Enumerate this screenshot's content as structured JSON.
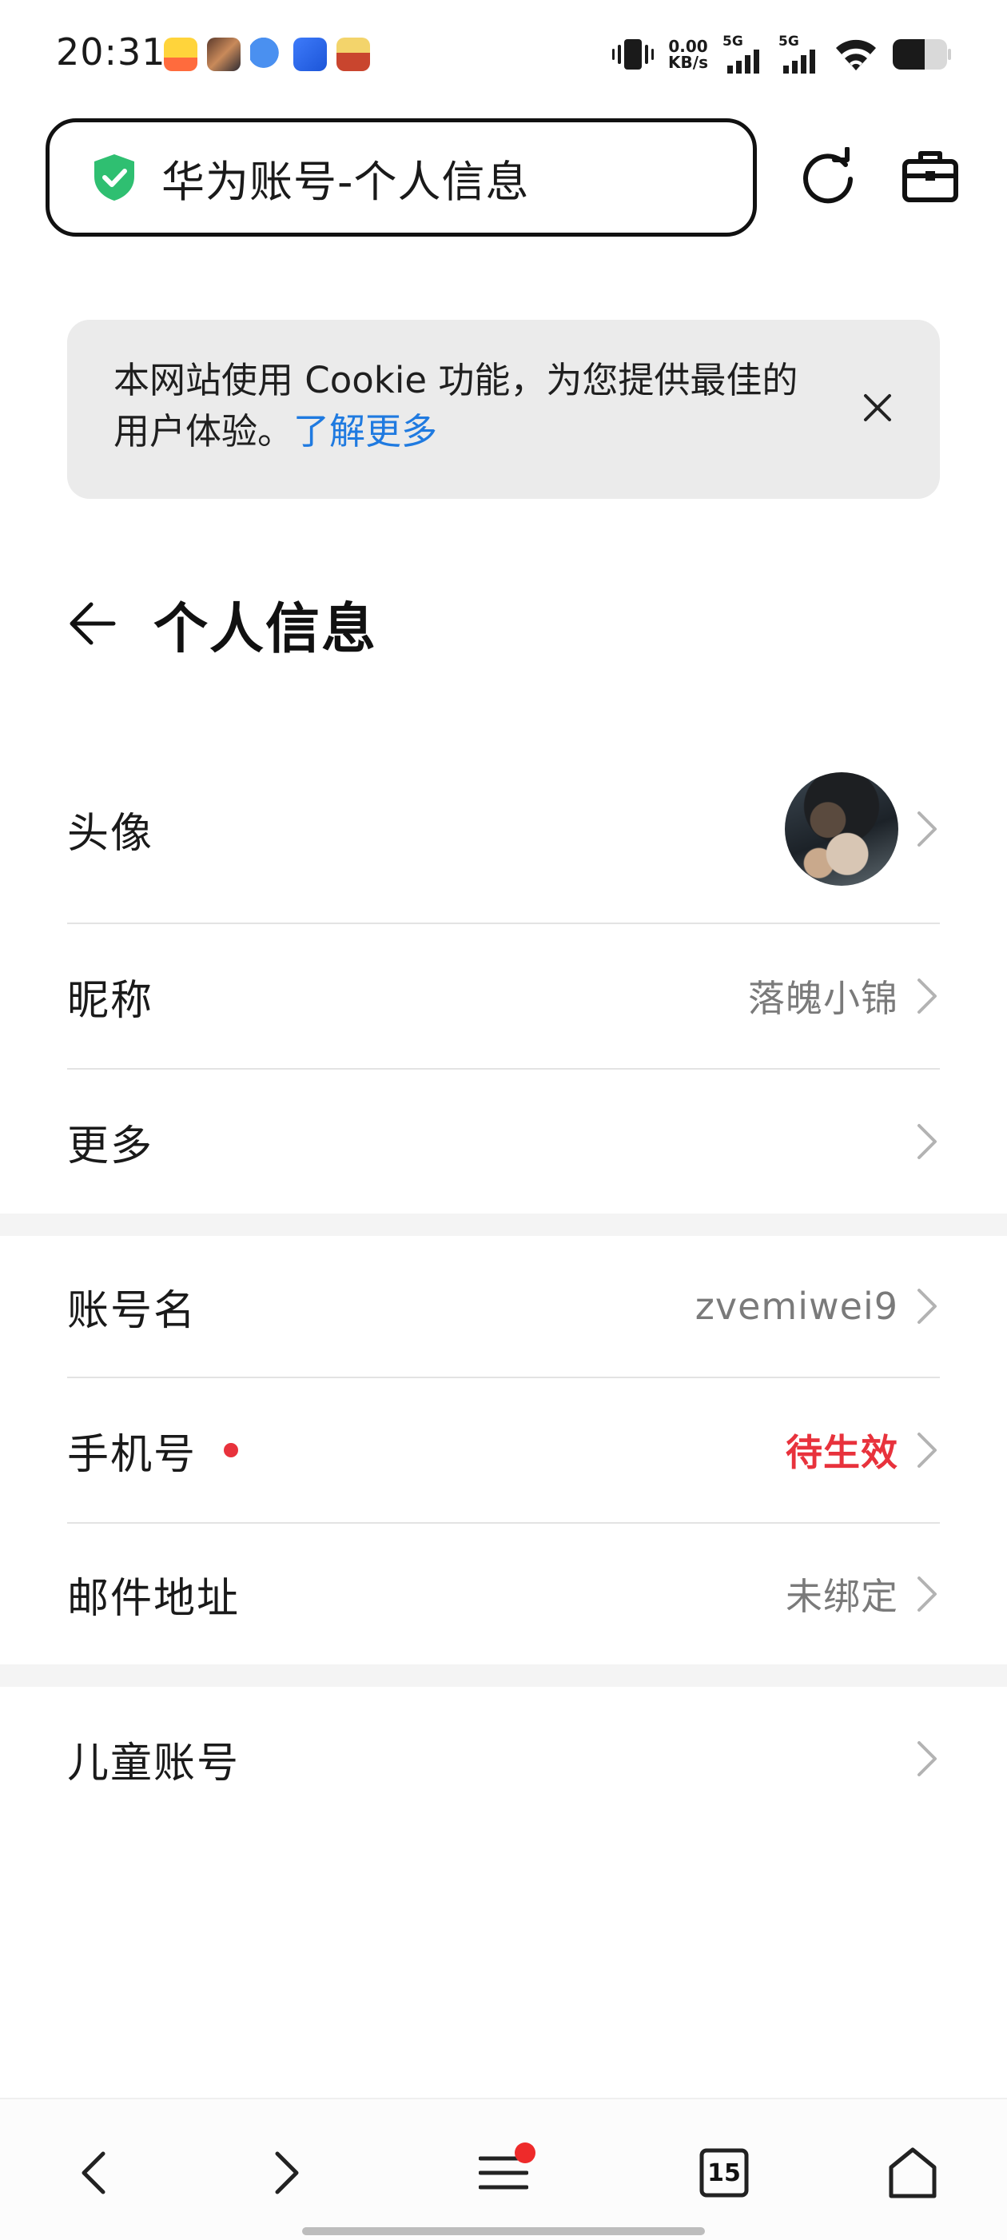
{
  "status_bar": {
    "time": "20:31",
    "net_speed_value": "0.00",
    "net_speed_unit": "KB/s",
    "sim1_label": "5G",
    "sim2_label": "5G",
    "app_icons": [
      "game-app-icon",
      "video-app-icon",
      "chat-app-icon",
      "browser-app-icon",
      "game2-app-icon"
    ],
    "battery_level": 0.35
  },
  "address_bar": {
    "title": "华为账号-个人信息",
    "secure_color": "#2fbf71"
  },
  "cookie_banner": {
    "text": "本网站使用 Cookie 功能，为您提供最佳的用户体验。",
    "link_text": "了解更多",
    "link_color": "#1f7ae0"
  },
  "page": {
    "title": "个人信息"
  },
  "profile": {
    "avatar": {
      "label": "头像"
    },
    "nickname": {
      "label": "昵称",
      "value": "落魄小锦"
    },
    "more": {
      "label": "更多"
    },
    "account_name": {
      "label": "账号名",
      "value": "zvemiwei9"
    },
    "phone": {
      "label": "手机号",
      "value": "待生效",
      "value_color": "#e8323c"
    },
    "email": {
      "label": "邮件地址",
      "value": "未绑定"
    },
    "child_account": {
      "label": "儿童账号"
    }
  },
  "bottom_nav": {
    "tab_count": "15"
  }
}
